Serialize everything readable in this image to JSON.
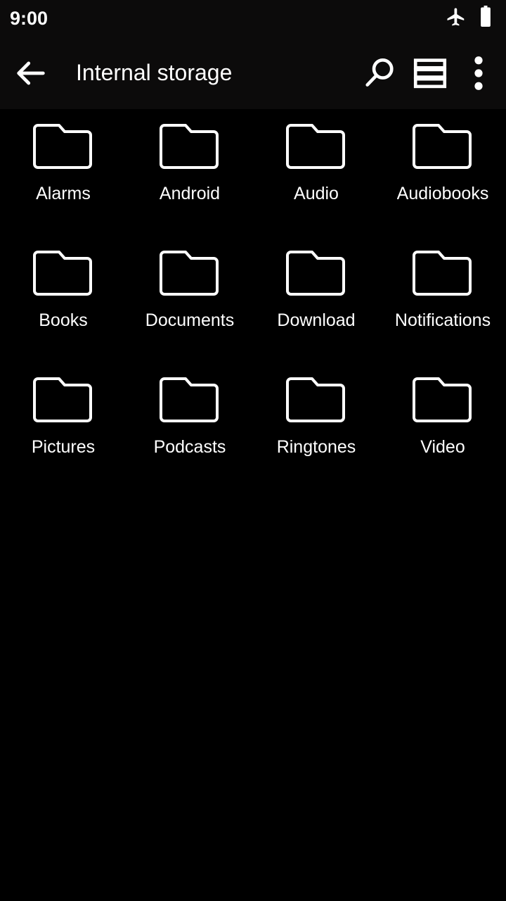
{
  "status_bar": {
    "clock": "9:00",
    "icons": [
      {
        "name": "airplane-mode-icon",
        "label": "Airplane mode"
      },
      {
        "name": "battery-full-icon",
        "label": "Battery full"
      }
    ],
    "background_color": "#0c0b0b",
    "foreground_color": "#ffffff"
  },
  "toolbar": {
    "back_label": "Navigate up",
    "title": "Internal storage",
    "actions": [
      {
        "name": "search-icon",
        "label": "Search"
      },
      {
        "name": "list-view-icon",
        "label": "List view"
      },
      {
        "name": "overflow-menu-icon",
        "label": "More options"
      }
    ],
    "background_color": "#0c0b0b"
  },
  "content": {
    "background_color": "#000000",
    "accent_color": "#ffffff",
    "columns": 4,
    "items": [
      {
        "name": "Alarms",
        "type": "folder"
      },
      {
        "name": "Android",
        "type": "folder"
      },
      {
        "name": "Audio",
        "type": "folder"
      },
      {
        "name": "Audiobooks",
        "type": "folder"
      },
      {
        "name": "Books",
        "type": "folder"
      },
      {
        "name": "Documents",
        "type": "folder"
      },
      {
        "name": "Download",
        "type": "folder"
      },
      {
        "name": "Notifications",
        "type": "folder"
      },
      {
        "name": "Pictures",
        "type": "folder"
      },
      {
        "name": "Podcasts",
        "type": "folder"
      },
      {
        "name": "Ringtones",
        "type": "folder"
      },
      {
        "name": "Video",
        "type": "folder"
      }
    ]
  }
}
